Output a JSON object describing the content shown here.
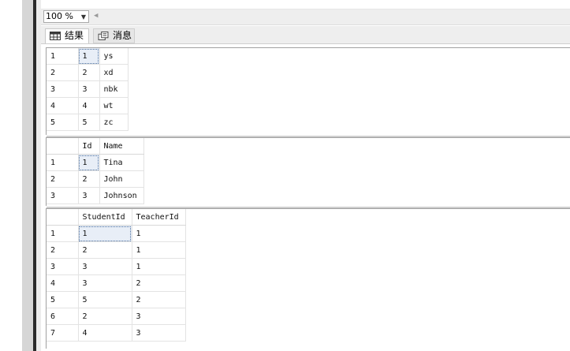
{
  "toolbar": {
    "zoom": "100 %"
  },
  "tabs": [
    {
      "label": "结果",
      "icon": "grid-icon",
      "active": true
    },
    {
      "label": "消息",
      "icon": "messages-icon",
      "active": false
    }
  ],
  "result_sets": [
    {
      "columns": [],
      "rows": [
        {
          "num": "1",
          "cells": [
            "1",
            "ys"
          ]
        },
        {
          "num": "2",
          "cells": [
            "2",
            "xd"
          ]
        },
        {
          "num": "3",
          "cells": [
            "3",
            "nbk"
          ]
        },
        {
          "num": "4",
          "cells": [
            "4",
            "wt"
          ]
        },
        {
          "num": "5",
          "cells": [
            "5",
            "zc"
          ]
        }
      ]
    },
    {
      "columns": [
        "Id",
        "Name"
      ],
      "rows": [
        {
          "num": "1",
          "cells": [
            "1",
            "Tina"
          ]
        },
        {
          "num": "2",
          "cells": [
            "2",
            "John"
          ]
        },
        {
          "num": "3",
          "cells": [
            "3",
            "Johnson"
          ]
        }
      ]
    },
    {
      "columns": [
        "StudentId",
        "TeacherId"
      ],
      "rows": [
        {
          "num": "1",
          "cells": [
            "1",
            "1"
          ]
        },
        {
          "num": "2",
          "cells": [
            "2",
            "1"
          ]
        },
        {
          "num": "3",
          "cells": [
            "3",
            "1"
          ]
        },
        {
          "num": "4",
          "cells": [
            "3",
            "2"
          ]
        },
        {
          "num": "5",
          "cells": [
            "5",
            "2"
          ]
        },
        {
          "num": "6",
          "cells": [
            "2",
            "3"
          ]
        },
        {
          "num": "7",
          "cells": [
            "4",
            "3"
          ]
        }
      ]
    }
  ]
}
